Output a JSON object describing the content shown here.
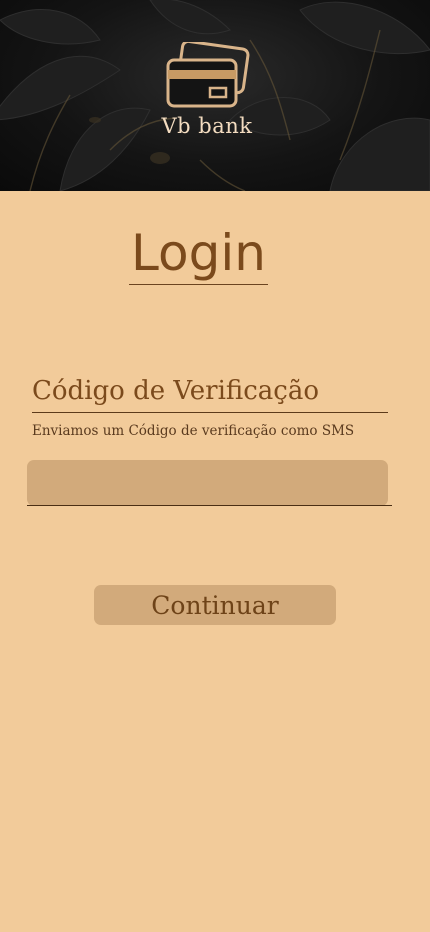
{
  "brand": {
    "name": "Vb bank",
    "logo_icon": "credit-cards-icon"
  },
  "login": {
    "title": "Login"
  },
  "verification": {
    "title": "Código de Verificação",
    "description": "Enviamos um Código de verificação como SMS",
    "input_value": "",
    "input_placeholder": ""
  },
  "actions": {
    "continue_label": "Continuar"
  },
  "colors": {
    "background": "#f2cb9a",
    "accent_brown": "#7b4a1c",
    "field_fill": "#d2aa7b",
    "header_dark": "#141414",
    "logo_gold": "#d9b48a"
  }
}
